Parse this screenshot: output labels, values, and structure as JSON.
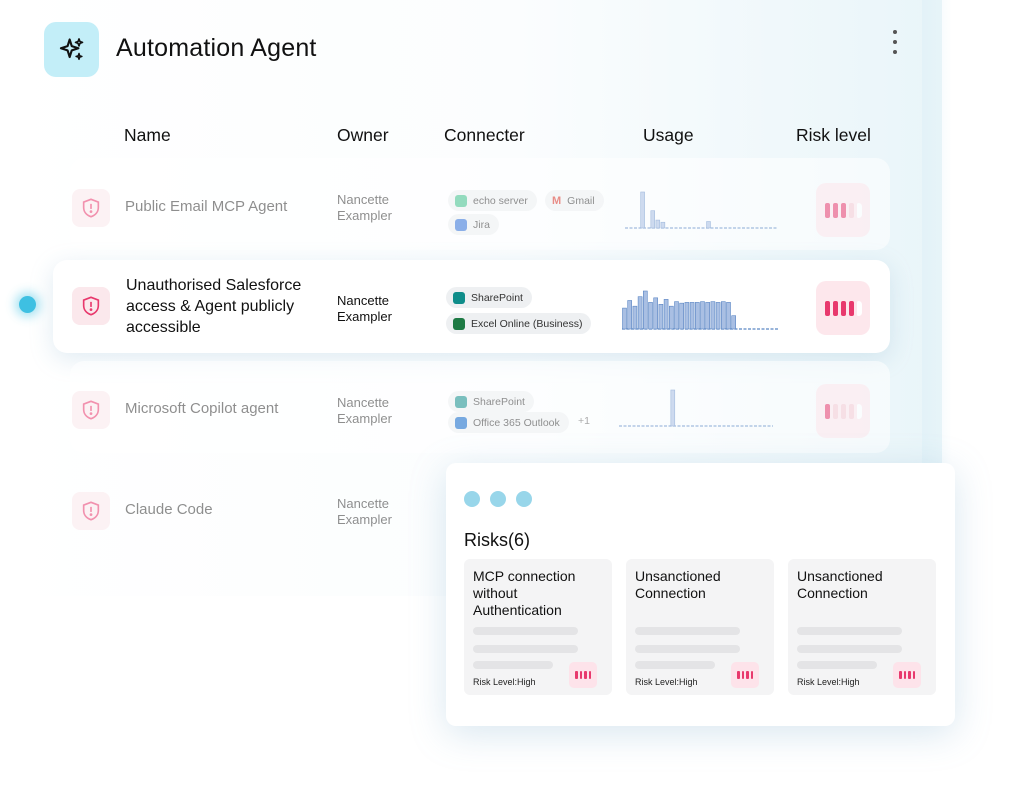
{
  "app": {
    "title": "Automation Agent",
    "icon": "sparkle-icon",
    "menu_icon": "kebab-menu-icon"
  },
  "columns": {
    "name": "Name",
    "owner": "Owner",
    "connecter": "Connecter",
    "usage": "Usage",
    "risk": "Risk level"
  },
  "rows": [
    {
      "name": "Public Email MCP Agent",
      "owner_first": "Nancette",
      "owner_last": "Exampler",
      "connectors": [
        "echo server",
        "Gmail",
        "Jira"
      ],
      "risk_level": 3
    },
    {
      "name": "Unauthorised Salesforce access & Agent publicly accessible",
      "owner_first": "Nancette",
      "owner_last": "Exampler",
      "connectors": [
        "SharePoint",
        "Excel Online (Business)"
      ],
      "risk_level": 4
    },
    {
      "name": "Microsoft Copilot agent",
      "owner_first": "Nancette",
      "owner_last": "Exampler",
      "connectors": [
        "SharePoint",
        "Office 365 Outlook"
      ],
      "connectors_more": "+1",
      "risk_level": 1
    },
    {
      "name": "Claude Code",
      "owner_first": "Nancette",
      "owner_last": "Exampler"
    }
  ],
  "risks_panel": {
    "title": "Risks(6)",
    "cards": [
      {
        "title": "MCP connection without Authentication",
        "level": "Risk Level:High"
      },
      {
        "title": "Unsanctioned Connection",
        "level": "Risk Level:High"
      },
      {
        "title": "Unsanctioned Connection",
        "level": "Risk Level:High"
      }
    ]
  },
  "colors": {
    "accent": "#3ec0e2",
    "risk": "#e8396d",
    "risk_bg": "#fde7ec",
    "icon_bg": "#c3eef8",
    "usage": "#5b86c4"
  }
}
